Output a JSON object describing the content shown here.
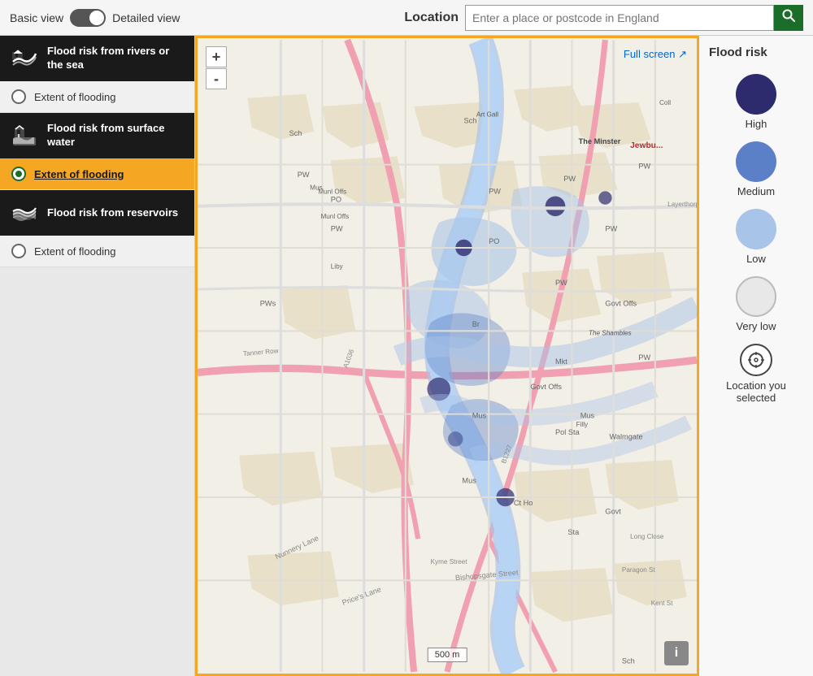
{
  "header": {
    "basic_view_label": "Basic view",
    "detailed_view_label": "Detailed view",
    "location_label": "Location",
    "search_placeholder": "Enter a place or postcode in England",
    "search_button_icon": "search-icon"
  },
  "sidebar": {
    "groups": [
      {
        "id": "rivers",
        "title": "Flood risk from rivers or the sea",
        "icon": "rivers-icon",
        "subitems": [
          {
            "id": "rivers-extent",
            "label": "Extent of flooding",
            "active": false
          }
        ]
      },
      {
        "id": "surface",
        "title": "Flood risk from surface water",
        "icon": "surface-water-icon",
        "subitems": [
          {
            "id": "surface-extent",
            "label": "Extent of flooding",
            "active": true
          }
        ]
      },
      {
        "id": "reservoirs",
        "title": "Flood risk from reservoirs",
        "icon": "reservoirs-icon",
        "subitems": [
          {
            "id": "reservoirs-extent",
            "label": "Extent of flooding",
            "active": false
          }
        ]
      }
    ]
  },
  "map": {
    "full_screen_label": "Full screen",
    "zoom_in_label": "+",
    "zoom_out_label": "-",
    "scale_label": "500 m",
    "info_label": "i"
  },
  "legend": {
    "title": "Flood risk",
    "items": [
      {
        "id": "high",
        "label": "High",
        "color": "#2d2b6e"
      },
      {
        "id": "medium",
        "label": "Medium",
        "color": "#5b80c8"
      },
      {
        "id": "low",
        "label": "Low",
        "color": "#a8c4e8"
      },
      {
        "id": "very-low",
        "label": "Very low",
        "color": "#e8e8e8",
        "border": "#bbb"
      }
    ],
    "location_selected_label": "Location you selected"
  }
}
